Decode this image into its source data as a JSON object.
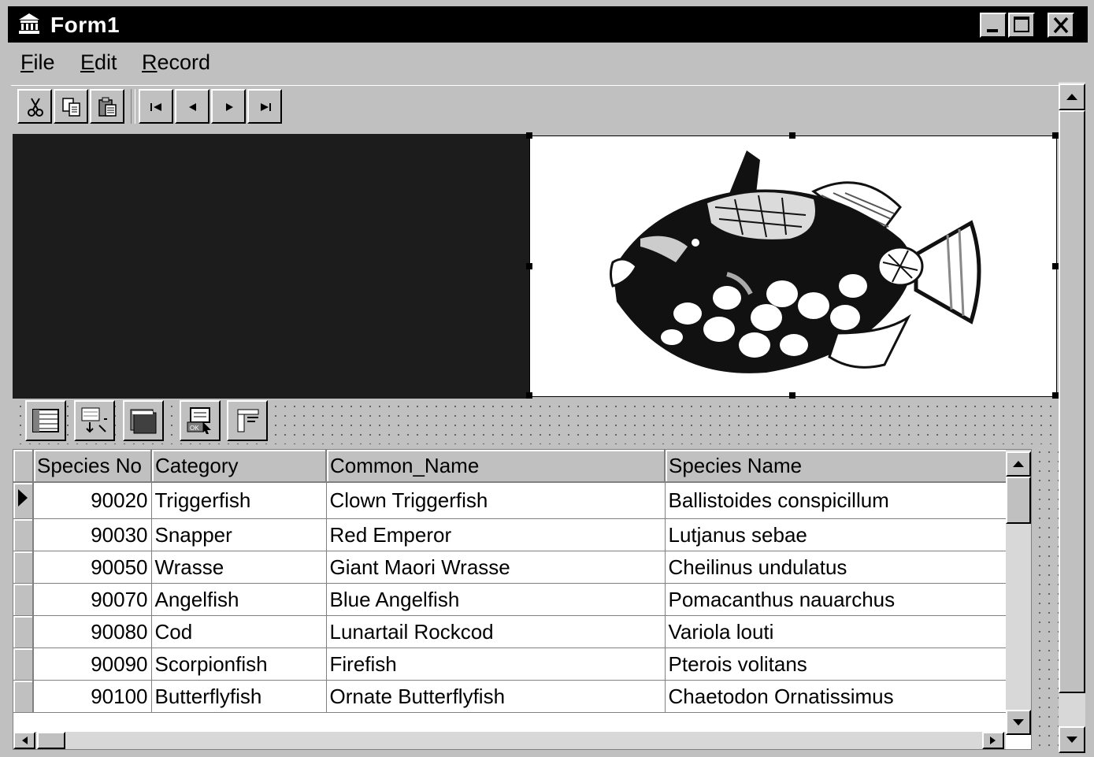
{
  "window": {
    "title": "Form1"
  },
  "menu": [
    {
      "label": "File",
      "accel": "F",
      "rest": "ile"
    },
    {
      "label": "Edit",
      "accel": "E",
      "rest": "dit"
    },
    {
      "label": "Record",
      "accel": "R",
      "rest": "ecord"
    }
  ],
  "toolbar": {
    "buttons": [
      "cut-icon",
      "copy-icon",
      "paste-icon",
      "first-record-icon",
      "prior-record-icon",
      "next-record-icon",
      "last-record-icon"
    ]
  },
  "palette": {
    "buttons": [
      "table-icon",
      "query-icon",
      "batch-move-icon",
      "db-login-icon",
      "report-icon"
    ]
  },
  "grid": {
    "columns": [
      "Species No",
      "Category",
      "Common_Name",
      "Species Name"
    ],
    "rows": [
      [
        "90020",
        "Triggerfish",
        "Clown Triggerfish",
        "Ballistoides conspicillum"
      ],
      [
        "90030",
        "Snapper",
        "Red Emperor",
        "Lutjanus sebae"
      ],
      [
        "90050",
        "Wrasse",
        "Giant Maori Wrasse",
        "Cheilinus undulatus"
      ],
      [
        "90070",
        "Angelfish",
        "Blue Angelfish",
        "Pomacanthus nauarchus"
      ],
      [
        "90080",
        "Cod",
        "Lunartail Rockcod",
        "Variola louti"
      ],
      [
        "90090",
        "Scorpionfish",
        "Firefish",
        "Pterois volitans"
      ],
      [
        "90100",
        "Butterflyfish",
        "Ornate Butterflyfish",
        "Chaetodon Ornatissimus"
      ]
    ],
    "current_row": 0
  },
  "colors": {
    "titlebar": "#000000",
    "face": "#c0c0c0",
    "panel": "#1c1c1c"
  }
}
